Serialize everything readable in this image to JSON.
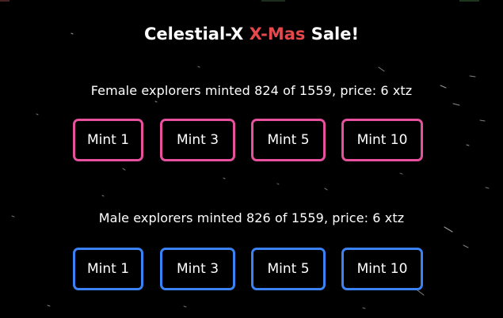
{
  "title": {
    "prefix": "Celestial-X ",
    "accent": "X-Mas",
    "suffix": " Sale!"
  },
  "female": {
    "status": "Female explorers minted 824 of 1559, price: 6 xtz",
    "minted": 824,
    "supply": 1559,
    "price": "6 xtz",
    "border_color": "#e6509c",
    "buttons": [
      "Mint 1",
      "Mint 3",
      "Mint 5",
      "Mint 10"
    ]
  },
  "male": {
    "status": "Male explorers minted 826 of 1559, price: 6 xtz",
    "minted": 826,
    "supply": 1559,
    "price": "6 xtz",
    "border_color": "#3b82f6",
    "buttons": [
      "Mint 1",
      "Mint 3",
      "Mint 5",
      "Mint 10"
    ]
  },
  "colors": {
    "background": "#000000",
    "accent": "#e5484d",
    "text": "#ffffff"
  }
}
